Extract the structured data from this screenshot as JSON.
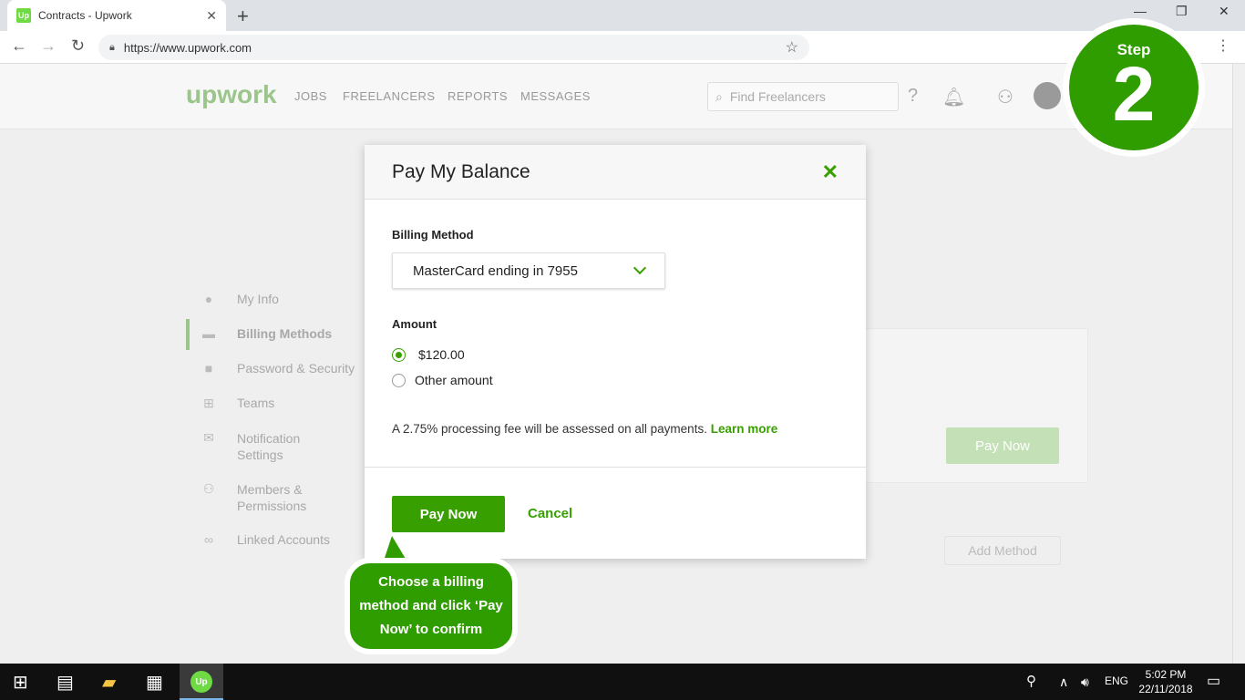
{
  "browser": {
    "tab_title": "Contracts - Upwork",
    "favicon_text": "Up",
    "url": "https://www.upwork.com"
  },
  "site": {
    "logo": "upwork",
    "nav": [
      "JOBS",
      "FREELANCERS",
      "REPORTS",
      "MESSAGES"
    ],
    "search_placeholder": "Find Freelancers"
  },
  "sidebar": {
    "items": [
      {
        "label": "My Info",
        "icon": "person-icon"
      },
      {
        "label": "Billing Methods",
        "icon": "card-icon"
      },
      {
        "label": "Password & Security",
        "icon": "lock-icon"
      },
      {
        "label": "Teams",
        "icon": "teams-icon"
      },
      {
        "label": "Notification Settings",
        "icon": "mail-icon"
      },
      {
        "label": "Members & Permissions",
        "icon": "members-icon"
      },
      {
        "label": "Linked Accounts",
        "icon": "link-icon"
      }
    ]
  },
  "background": {
    "pay_now": "Pay Now",
    "add_method": "Add Method"
  },
  "modal": {
    "title": "Pay My Balance",
    "billing_label": "Billing Method",
    "billing_value": "MasterCard ending in 7955",
    "amount_label": "Amount",
    "option_full": "$120.00",
    "option_other": "Other amount",
    "fee_text": "A 2.75% processing fee will be assessed on all payments.",
    "learn_more": "Learn more",
    "pay_now": "Pay Now",
    "cancel": "Cancel"
  },
  "callout": {
    "text": "Choose a billing method and click ‘Pay Now’ to confirm"
  },
  "step": {
    "word": "Step",
    "number": "2"
  },
  "taskbar": {
    "lang": "ENG",
    "time": "5:02 PM",
    "date": "22/11/2018"
  },
  "colors": {
    "brand_green": "#37a000",
    "callout_green": "#2f9c00"
  }
}
